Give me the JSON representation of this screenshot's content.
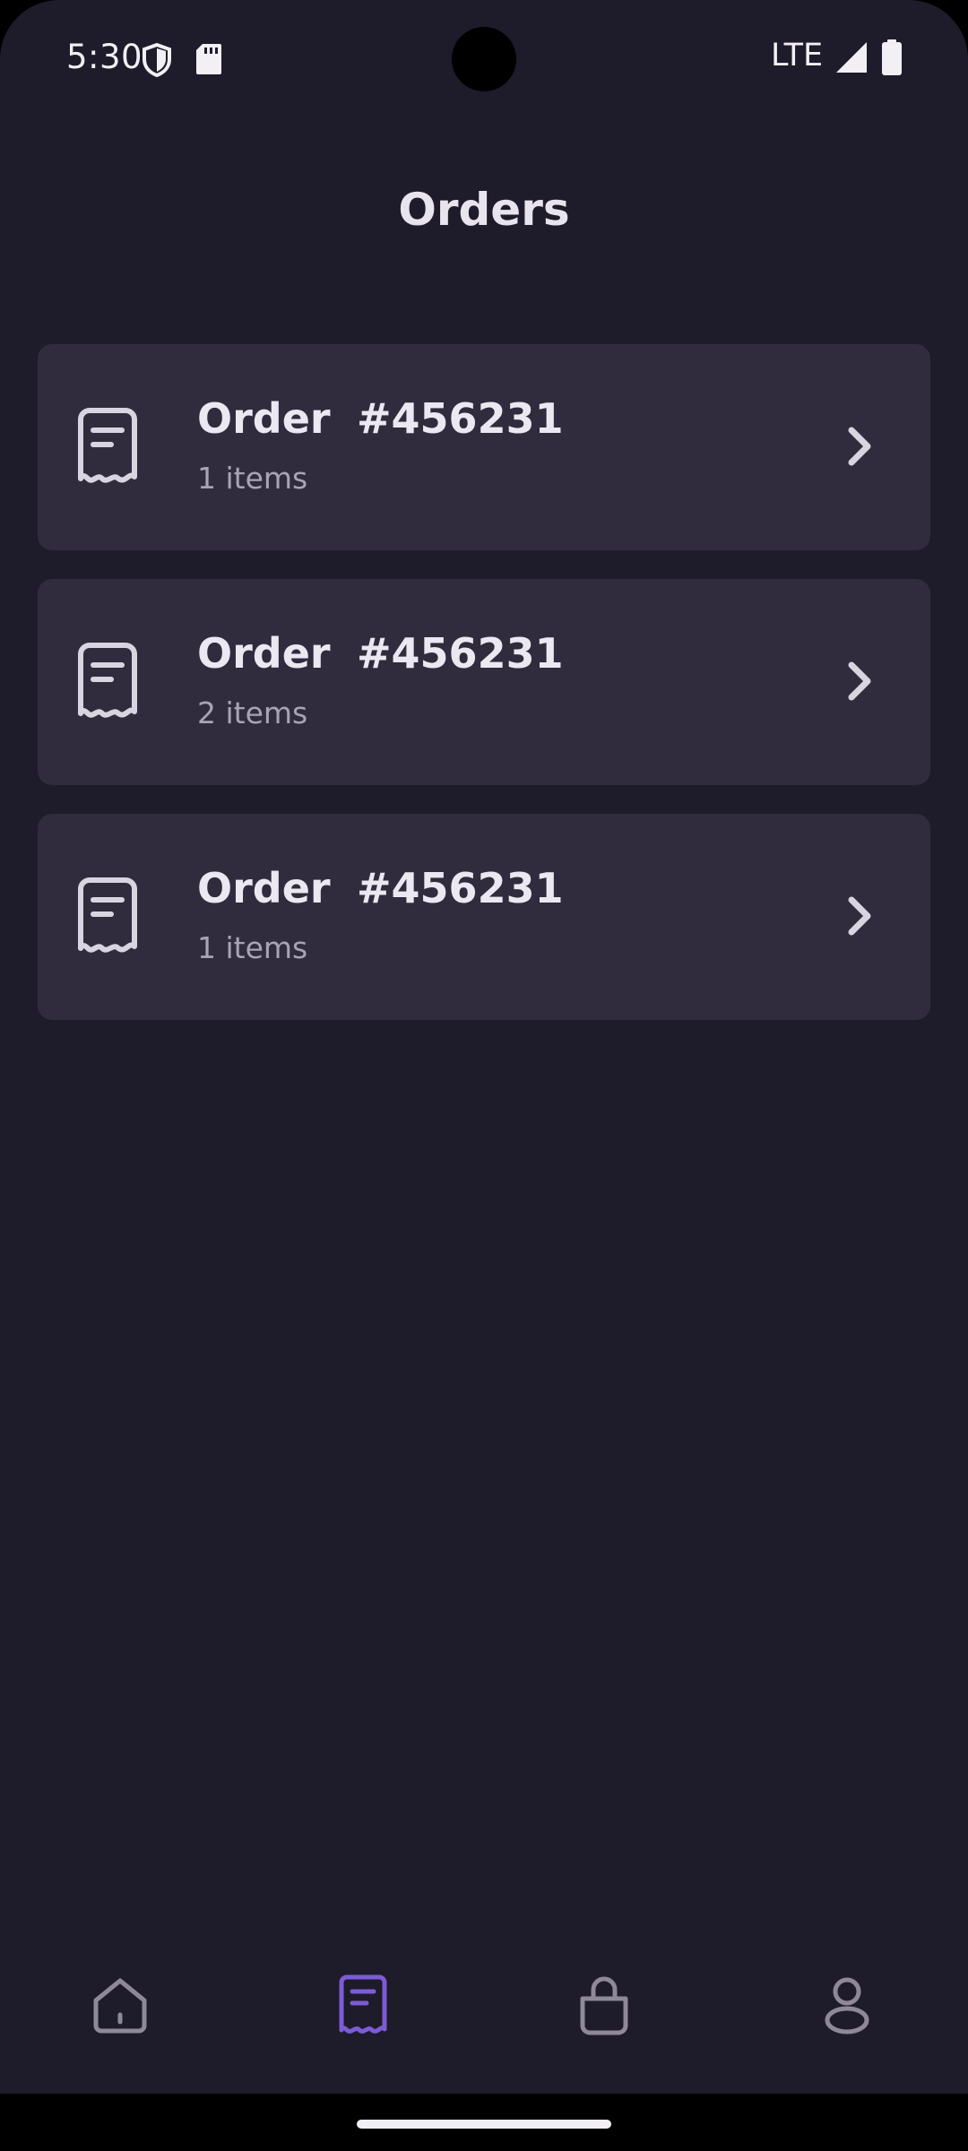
{
  "status_bar": {
    "time": "5:30",
    "network": "LTE",
    "icons": [
      "vpn-shield-icon",
      "sd-card-icon",
      "signal-icon",
      "battery-icon"
    ]
  },
  "header": {
    "title": "Orders"
  },
  "orders": [
    {
      "label": "Order",
      "number": "#456231",
      "items": "1 items"
    },
    {
      "label": "Order",
      "number": "#456231",
      "items": "2 items"
    },
    {
      "label": "Order",
      "number": "#456231",
      "items": "1 items"
    }
  ],
  "bottom_nav": {
    "items": [
      {
        "name": "home",
        "icon": "home-icon",
        "active": false
      },
      {
        "name": "orders",
        "icon": "receipt-icon",
        "active": true
      },
      {
        "name": "cart",
        "icon": "shopping-bag-icon",
        "active": false
      },
      {
        "name": "profile",
        "icon": "user-icon",
        "active": false
      }
    ]
  },
  "colors": {
    "background": "#1E1B2A",
    "card": "#302C3D",
    "accent": "#7C5CD6",
    "text_primary": "#ECE8F2",
    "text_secondary": "#A9A3B5",
    "icon_inactive": "#8E8899"
  }
}
